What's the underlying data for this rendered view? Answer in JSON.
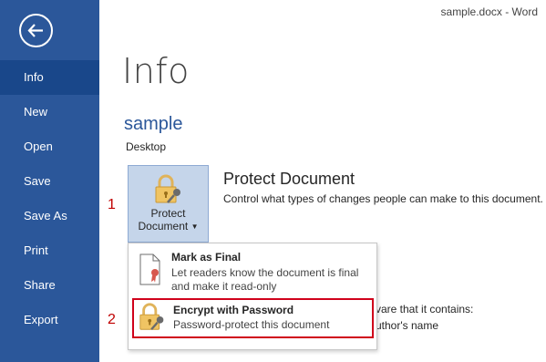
{
  "window": {
    "title": "sample.docx - Word"
  },
  "sidebar": {
    "items": [
      {
        "label": "Info"
      },
      {
        "label": "New"
      },
      {
        "label": "Open"
      },
      {
        "label": "Save"
      },
      {
        "label": "Save As"
      },
      {
        "label": "Print"
      },
      {
        "label": "Share"
      },
      {
        "label": "Export"
      }
    ]
  },
  "main": {
    "title": "Info",
    "doc_name": "sample",
    "doc_location": "Desktop",
    "protect": {
      "button_line1": "Protect",
      "button_line2": "Document",
      "heading": "Protect Document",
      "description": "Control what types of changes people can make to this document."
    },
    "background_text": {
      "line1": "vare that it contains:",
      "line2": "uthor's name"
    }
  },
  "annotations": {
    "step1": "1",
    "step2": "2"
  },
  "dropdown": {
    "items": [
      {
        "title": "Mark as Final",
        "description": "Let readers know the document is final and make it read-only"
      },
      {
        "title": "Encrypt with Password",
        "description": "Password-protect this document"
      }
    ]
  },
  "colors": {
    "accent": "#2b579a",
    "active": "#19478a",
    "highlight": "#d0021b",
    "annotation": "#c00000"
  },
  "icons": {
    "back": "back-arrow-icon",
    "protect": "lock-key-icon",
    "final": "document-ribbon-icon",
    "encrypt": "lock-key-icon"
  }
}
